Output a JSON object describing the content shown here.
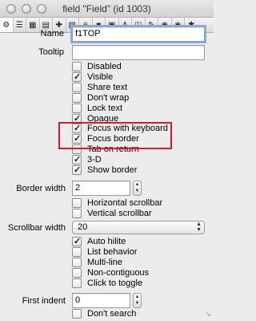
{
  "window": {
    "title": "field \"Field\" (id 1003)"
  },
  "toolbar": {
    "icons": [
      "gear-icon",
      "list-icon",
      "grid-icon",
      "text-icon",
      "move-icon",
      "size-icon",
      "align-icon",
      "color-icon",
      "image-icon",
      "textformat-icon",
      "table-icon",
      "script-icon",
      "prefs-icon",
      "settings-icon",
      "tools-icon"
    ]
  },
  "fields": {
    "name_label": "Name",
    "name_value": "f1TOP",
    "tooltip_label": "Tooltip",
    "tooltip_value": ""
  },
  "checkboxes": [
    {
      "label": "Disabled",
      "checked": false
    },
    {
      "label": "Visible",
      "checked": true
    },
    {
      "label": "Share text",
      "checked": false
    },
    {
      "label": "Don't wrap",
      "checked": false
    },
    {
      "label": "Lock text",
      "checked": false
    },
    {
      "label": "Opaque",
      "checked": true
    },
    {
      "label": "Focus with keyboard",
      "checked": true
    },
    {
      "label": "Focus border",
      "checked": true
    },
    {
      "label": "Tab on return",
      "checked": false
    },
    {
      "label": "3-D",
      "checked": true
    },
    {
      "label": "Show border",
      "checked": true
    }
  ],
  "border_width": {
    "label": "Border width",
    "value": "2"
  },
  "scrollbars": [
    {
      "label": "Horizontal scrollbar",
      "checked": false
    },
    {
      "label": "Vertical scrollbar",
      "checked": false
    }
  ],
  "scrollbar_width": {
    "label": "Scrollbar width",
    "value": "20"
  },
  "list_options": [
    {
      "label": "Auto hilite",
      "checked": true
    },
    {
      "label": "List behavior",
      "checked": false
    },
    {
      "label": "Multi-line",
      "checked": false
    },
    {
      "label": "Non-contiguous",
      "checked": false
    },
    {
      "label": "Click to toggle",
      "checked": false
    }
  ],
  "first_indent": {
    "label": "First indent",
    "value": "0"
  },
  "dont_search": {
    "label": "Don't search",
    "checked": false
  }
}
